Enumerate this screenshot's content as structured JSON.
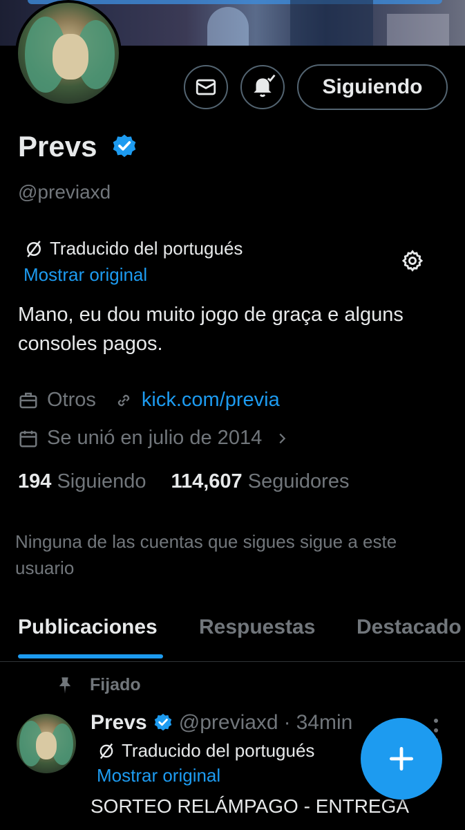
{
  "profile": {
    "name": "Prevs",
    "handle": "@previaxd",
    "follow_button": "Siguiendo",
    "translated_label": "Traducido del portugués",
    "show_original": "Mostrar original",
    "bio": "Mano, eu dou muito jogo de graça e alguns consoles pagos.",
    "category": "Otros",
    "link": "kick.com/previa",
    "joined": "Se unió en julio de 2014",
    "following_count": "194",
    "following_label": "Siguiendo",
    "followers_count": "114,607",
    "followers_label": "Seguidores",
    "mutuals_note": "Ninguna de las cuentas que sigues sigue a este usuario"
  },
  "tabs": [
    {
      "label": "Publicaciones",
      "active": true
    },
    {
      "label": "Respuestas",
      "active": false
    },
    {
      "label": "Destacado",
      "active": false
    }
  ],
  "post": {
    "pinned_label": "Fijado",
    "author": "Prevs",
    "handle": "@previaxd",
    "sep": "·",
    "time": "34min",
    "translated_label": "Traducido del portugués",
    "show_original": "Mostrar original",
    "text": "SORTEO RELÁMPAGO - ENTREGA"
  },
  "colors": {
    "accent": "#1d9bf0",
    "background": "#000000",
    "text_primary": "#e7e9ea",
    "text_secondary": "#71767b",
    "border": "#536471"
  },
  "icons": {
    "message": "mail-icon",
    "notifications": "bell-check-icon",
    "verified": "verified-badge-icon",
    "translate": "translate-slash-icon",
    "settings": "gear-icon",
    "category": "briefcase-icon",
    "link": "link-icon",
    "calendar": "calendar-icon",
    "pin": "pin-icon",
    "compose": "plus-icon"
  }
}
